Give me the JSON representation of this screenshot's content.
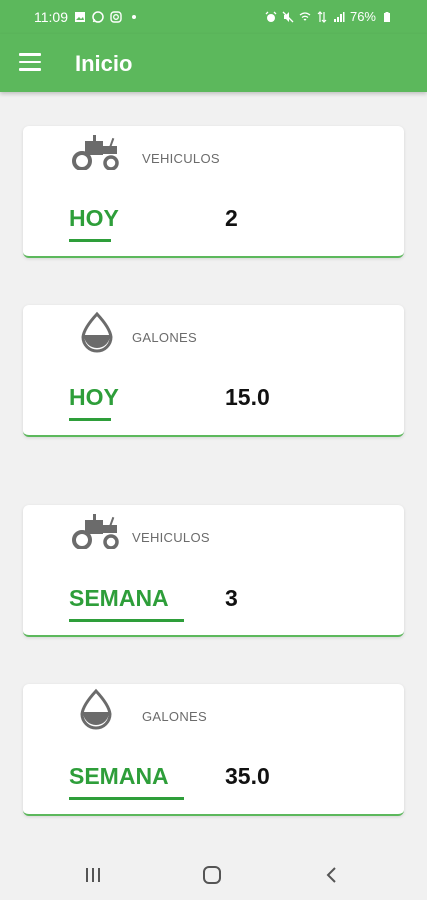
{
  "status_bar": {
    "time": "11:09",
    "battery": "76%",
    "left_icons": [
      "gallery-icon",
      "whatsapp-icon",
      "instagram-icon",
      "dot-icon"
    ],
    "right_icons": [
      "alarm-icon",
      "mute-icon",
      "wifi-icon",
      "data-icon",
      "signal-icon",
      "battery-icon"
    ]
  },
  "app_bar": {
    "title": "Inicio",
    "menu_icon": "menu-icon",
    "color": "#5cb85c"
  },
  "cards": [
    {
      "icon": "tractor-icon",
      "label": "VEHICULOS",
      "period": "HOY",
      "value": "2"
    },
    {
      "icon": "drop-icon",
      "label": "GALONES",
      "period": "HOY",
      "value": "15.0"
    },
    {
      "icon": "tractor-icon",
      "label": "VEHICULOS",
      "period": "SEMANA",
      "value": "3"
    },
    {
      "icon": "drop-icon",
      "label": "GALONES",
      "period": "SEMANA",
      "value": "35.0"
    }
  ],
  "accent_color": "#2e9e3a",
  "nav_bar": {
    "buttons": [
      "recents-icon",
      "home-icon",
      "back-icon"
    ]
  }
}
